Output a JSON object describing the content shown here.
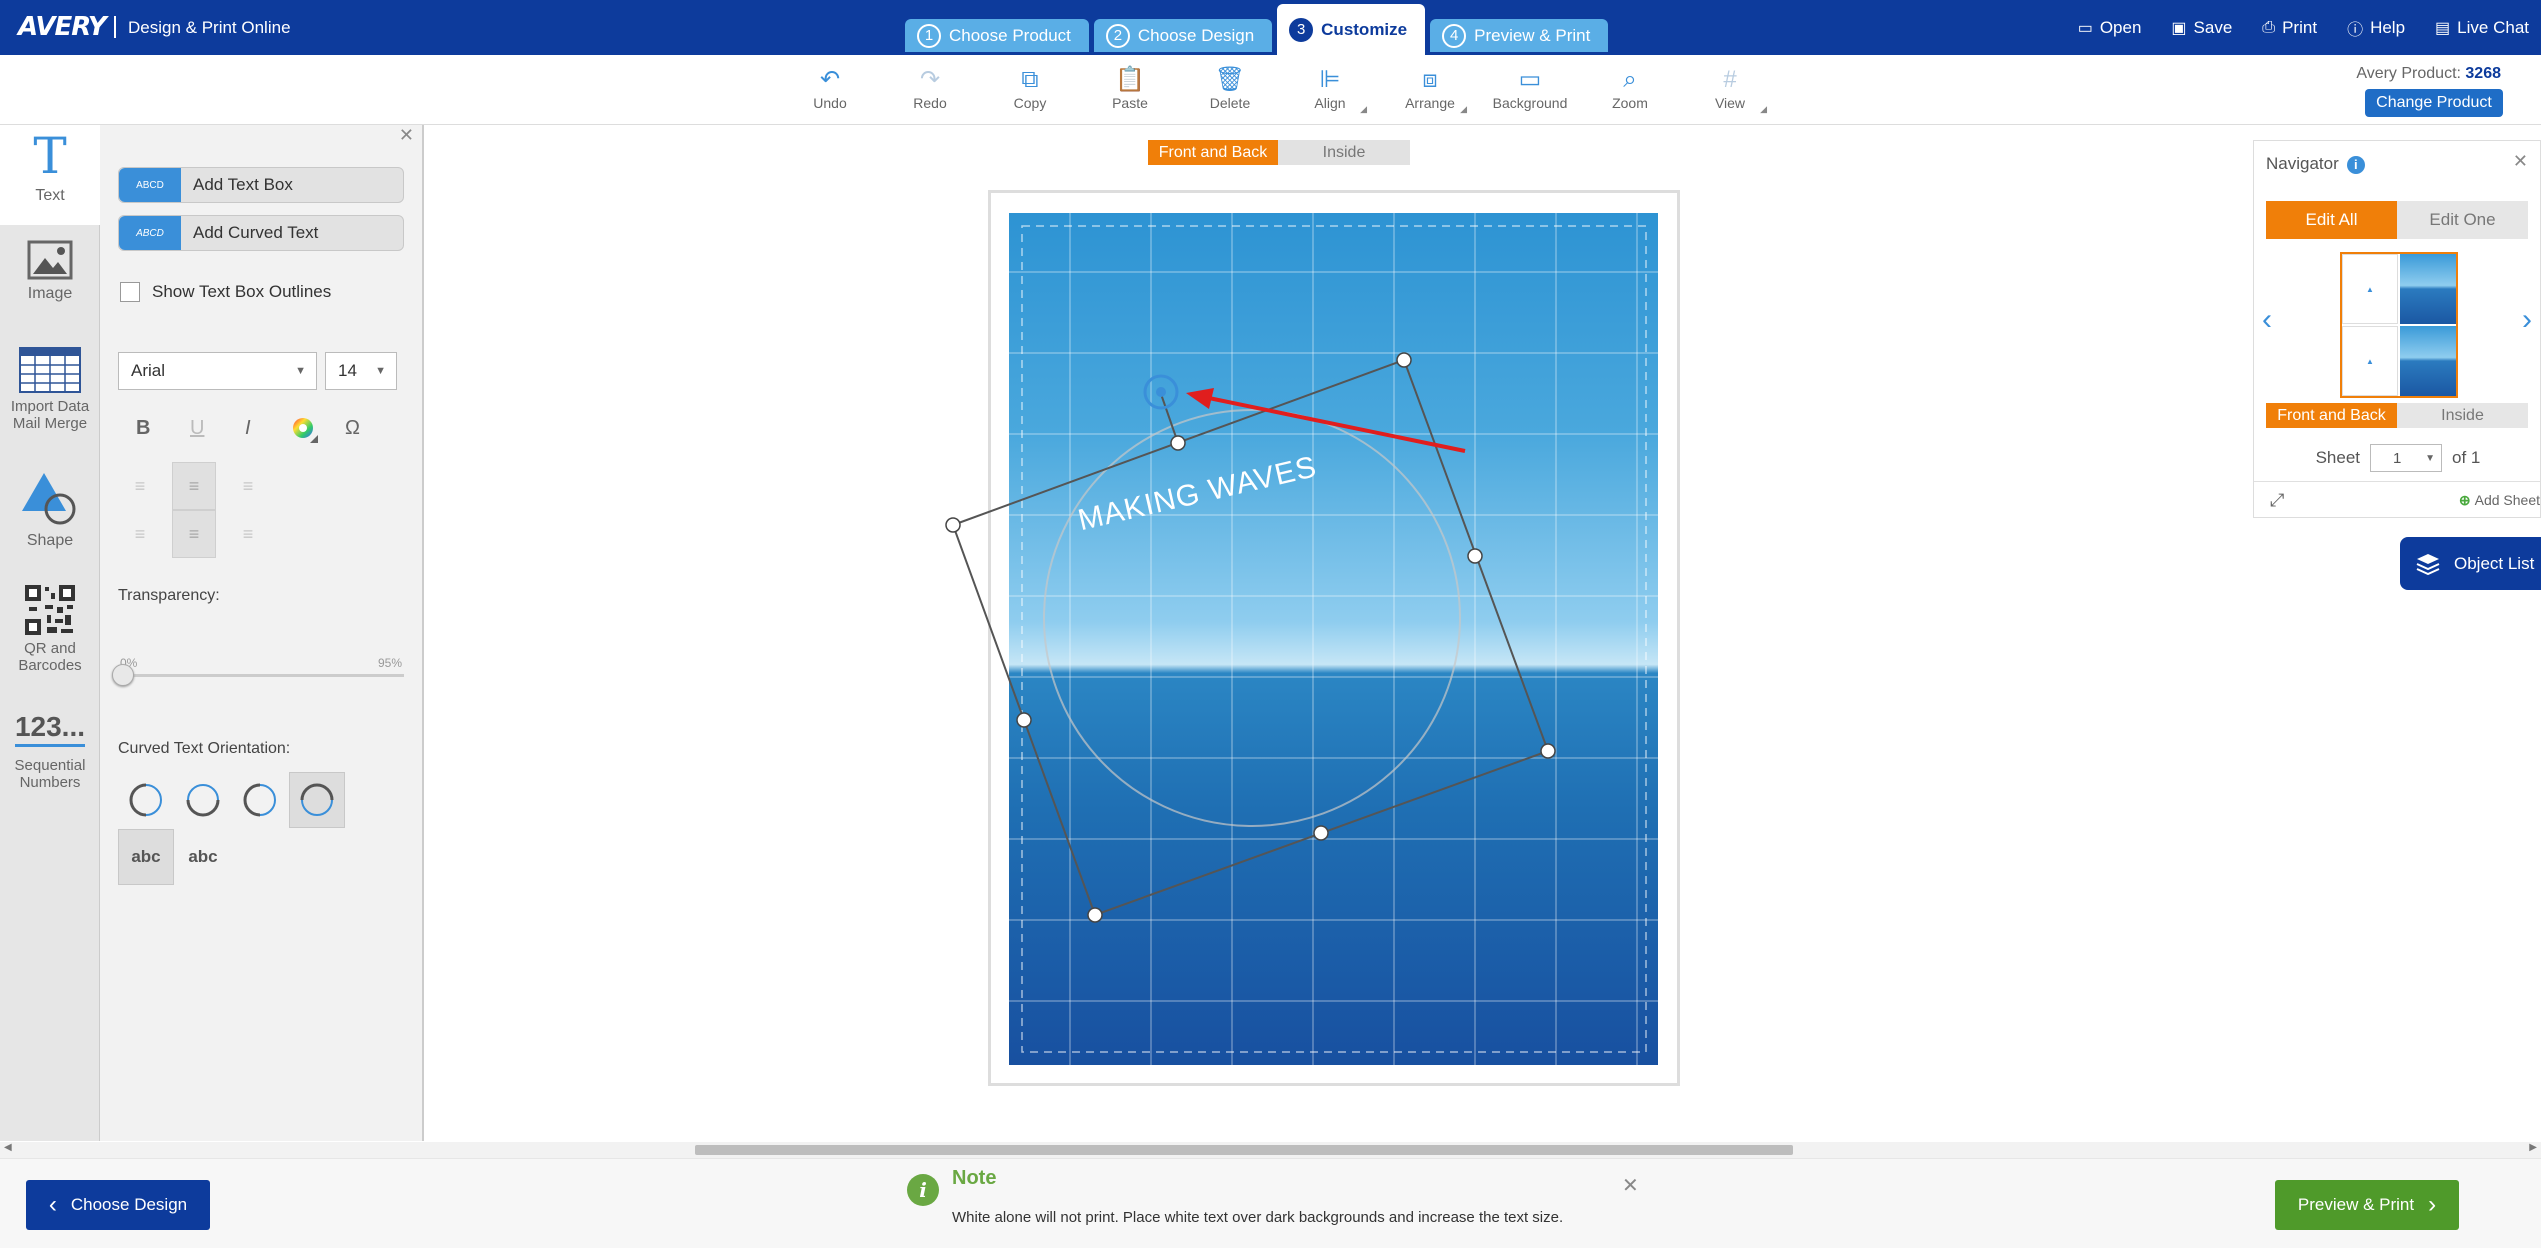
{
  "header": {
    "logo": "AVERY",
    "tagline": "Design & Print Online",
    "steps": [
      {
        "num": "1",
        "label": "Choose Product"
      },
      {
        "num": "2",
        "label": "Choose Design"
      },
      {
        "num": "3",
        "label": "Customize"
      },
      {
        "num": "4",
        "label": "Preview & Print"
      }
    ],
    "actions": {
      "open": "Open",
      "save": "Save",
      "print": "Print",
      "help": "Help",
      "chat": "Live Chat"
    }
  },
  "toolbar": {
    "undo": "Undo",
    "redo": "Redo",
    "copy": "Copy",
    "paste": "Paste",
    "delete": "Delete",
    "align": "Align",
    "arrange": "Arrange",
    "background": "Background",
    "zoom": "Zoom",
    "view": "View",
    "product_label": "Avery Product:",
    "product_number": "3268",
    "change_product": "Change Product"
  },
  "rail": {
    "text": "Text",
    "image": "Image",
    "import_line1": "Import Data",
    "import_line2": "Mail Merge",
    "shape": "Shape",
    "qr_line1": "QR and",
    "qr_line2": "Barcodes",
    "seq_icon": "123...",
    "seq_line1": "Sequential",
    "seq_line2": "Numbers"
  },
  "panel": {
    "add_text_box": "Add Text Box",
    "add_text_box_icon": "ABCD",
    "add_curved_text": "Add Curved Text",
    "add_curved_text_icon": "ABCD",
    "show_outlines": "Show Text Box Outlines",
    "font": "Arial",
    "size": "14",
    "bold": "B",
    "underline": "U",
    "italic": "I",
    "omega": "Ω",
    "transparency_label": "Transparency:",
    "transparency_min": "0%",
    "transparency_max": "95%",
    "transparency_value": 0,
    "curved_label": "Curved Text Orientation:",
    "abc_top": "abc",
    "abc_bottom": "abc"
  },
  "canvas": {
    "face_front": "Front and Back",
    "face_inside": "Inside",
    "text": "MAKING WAVES"
  },
  "navigator": {
    "title": "Navigator",
    "info": "i",
    "edit_all": "Edit All",
    "edit_one": "Edit One",
    "face_front": "Front and Back",
    "face_inside": "Inside",
    "sheet_label": "Sheet",
    "sheet_value": "1",
    "sheet_of": "of 1",
    "add_sheet": "Add Sheet"
  },
  "object_list": "Object List",
  "footer": {
    "back": "Choose Design",
    "note_title": "Note",
    "note_text": "White alone will not print. Place white text over dark backgrounds and increase the text size.",
    "next": "Preview & Print"
  },
  "colors": {
    "brand": "#0d3b9c",
    "accent": "#f07f09",
    "blue": "#3a8fd9",
    "green": "#6aa843"
  }
}
